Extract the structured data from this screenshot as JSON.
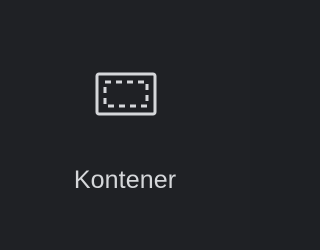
{
  "widget": {
    "label": "Kontener",
    "icon": "container-icon"
  },
  "colors": {
    "background": "#1f2125",
    "text": "#d5d7da",
    "icon": "#d5d7da"
  }
}
